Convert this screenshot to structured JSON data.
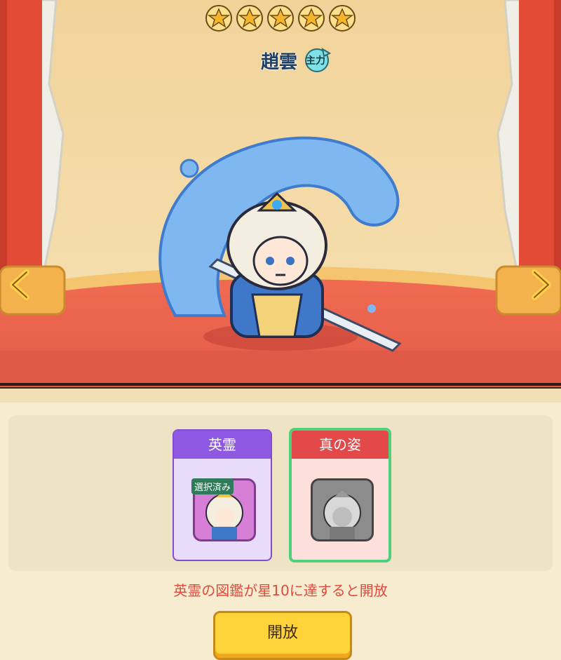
{
  "hero": {
    "name": "趙雲",
    "role_badge": "主力",
    "stars": 5
  },
  "nav": {
    "left_icon": "chevron-left-icon",
    "right_icon": "chevron-right-icon"
  },
  "skins": {
    "items": [
      {
        "title": "英霊",
        "tag": "選択済み",
        "locked": false
      },
      {
        "title": "真の姿",
        "tag": "",
        "locked": true
      }
    ]
  },
  "unlock_hint": "英霊の図鑑が星10に達すると開放",
  "button": {
    "label": "開放"
  },
  "colors": {
    "accent_purple": "#8e58e2",
    "accent_red": "#e34949",
    "accent_green": "#4fd07a",
    "button_yellow": "#ffd33a",
    "hint_red": "#e04a3c"
  }
}
